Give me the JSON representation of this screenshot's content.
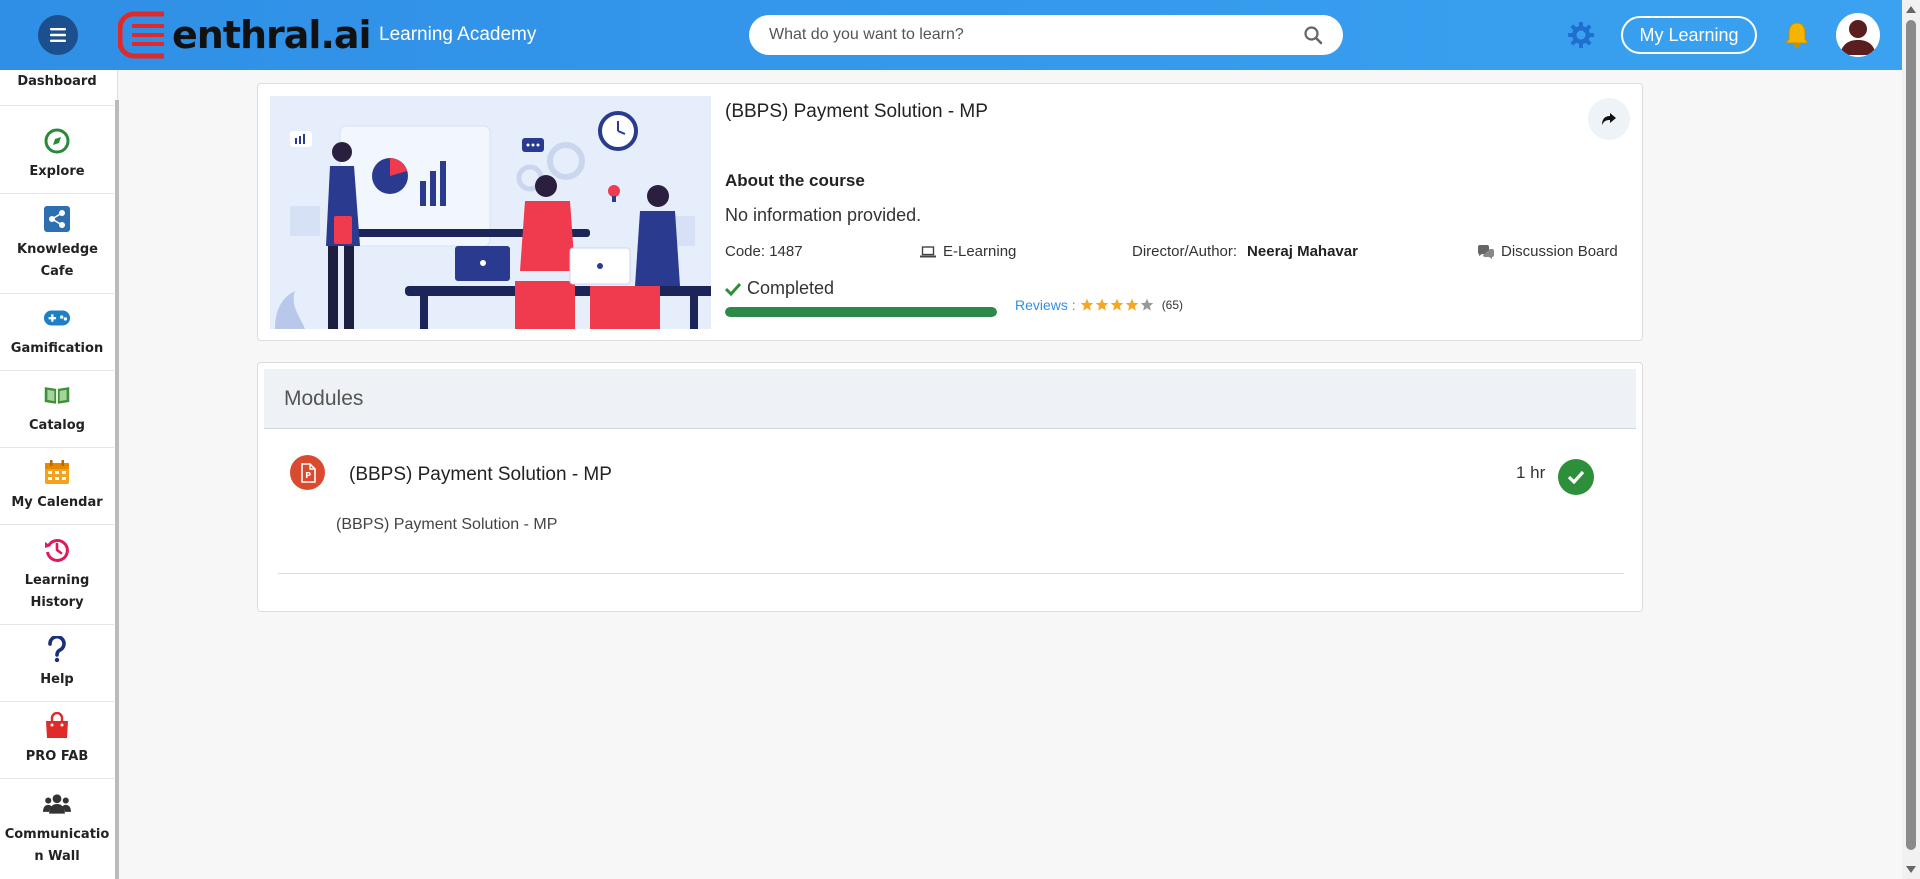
{
  "header": {
    "menu_icon": "hamburger-icon",
    "logo_text": "enthral.ai",
    "academy_label": "Learning Academy",
    "search_placeholder": "What do you want to learn?",
    "my_learning_label": "My Learning",
    "brand_color": "#2f8fe6"
  },
  "sidebar": {
    "items": [
      {
        "label": "Dashboard",
        "icon": "dashboard-icon"
      },
      {
        "label": "Explore",
        "icon": "compass-icon"
      },
      {
        "label": "Knowledge Cafe",
        "icon": "share-icon"
      },
      {
        "label": "Gamification",
        "icon": "gamepad-icon"
      },
      {
        "label": "Catalog",
        "icon": "book-icon"
      },
      {
        "label": "My Calendar",
        "icon": "calendar-icon"
      },
      {
        "label": "Learning History",
        "icon": "history-icon"
      },
      {
        "label": "Help",
        "icon": "question-icon"
      },
      {
        "label": "PRO FAB",
        "icon": "shopping-bag-icon"
      },
      {
        "label": "Communication Wall",
        "icon": "users-icon"
      }
    ]
  },
  "course": {
    "title": "(BBPS) Payment Solution - MP",
    "about_heading": "About the course",
    "about_text": "No information provided.",
    "code": "Code: 1487",
    "type": "E-Learning",
    "director_label": "Director/Author:",
    "director_name": "Neeraj Mahavar",
    "discussion_label": "Discussion Board",
    "status": "Completed",
    "progress_fraction": 1.0,
    "reviews_label": "Reviews :",
    "rating": 4,
    "rating_max": 5,
    "review_count": "(65)"
  },
  "modules": {
    "heading": "Modules",
    "items": [
      {
        "title": "(BBPS) Payment Solution - MP",
        "duration": "1 hr",
        "description": "(BBPS) Payment Solution - MP",
        "status": "completed"
      }
    ]
  }
}
